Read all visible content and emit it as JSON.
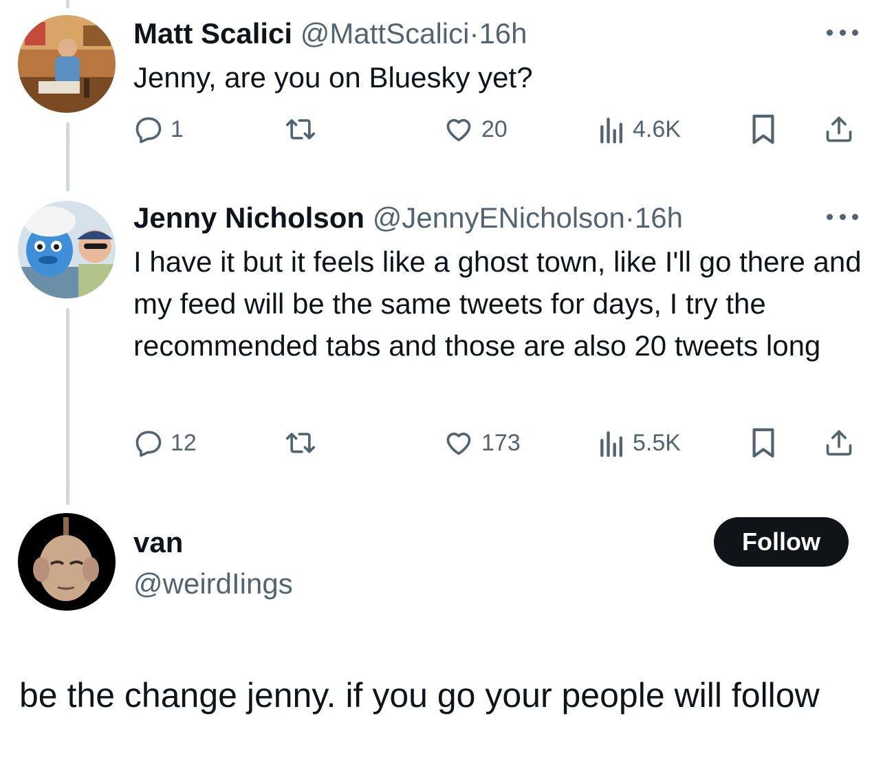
{
  "tweets": [
    {
      "name": "Matt Scalici",
      "handle": "@MattScalici",
      "separator": "·",
      "time": "16h",
      "text": "Jenny, are you on Bluesky yet?",
      "replies": "1",
      "retweets": "",
      "likes": "20",
      "views": "4.6K"
    },
    {
      "name": "Jenny Nicholson",
      "handle": "@JennyENicholson",
      "separator": "·",
      "time": "16h",
      "text": "I have it but it feels like a ghost town, like I'll go there and my feed will be the same tweets for days, I try the recommended tabs and those are also 20 tweets long",
      "replies": "12",
      "retweets": "",
      "likes": "173",
      "views": "5.5K"
    }
  ],
  "main_tweet": {
    "name": "van",
    "handle": "@weirdIings",
    "follow_label": "Follow",
    "text": "be the change jenny. if you go your people will follow"
  },
  "icons": {
    "reply": "reply-icon",
    "retweet": "retweet-icon",
    "like": "heart-icon",
    "views": "views-icon",
    "bookmark": "bookmark-icon",
    "share": "share-icon",
    "more": "more-icon"
  },
  "colors": {
    "text": "#0f1419",
    "secondary": "#536471",
    "thread_line": "#cfd9de",
    "follow_bg": "#0f1419"
  }
}
